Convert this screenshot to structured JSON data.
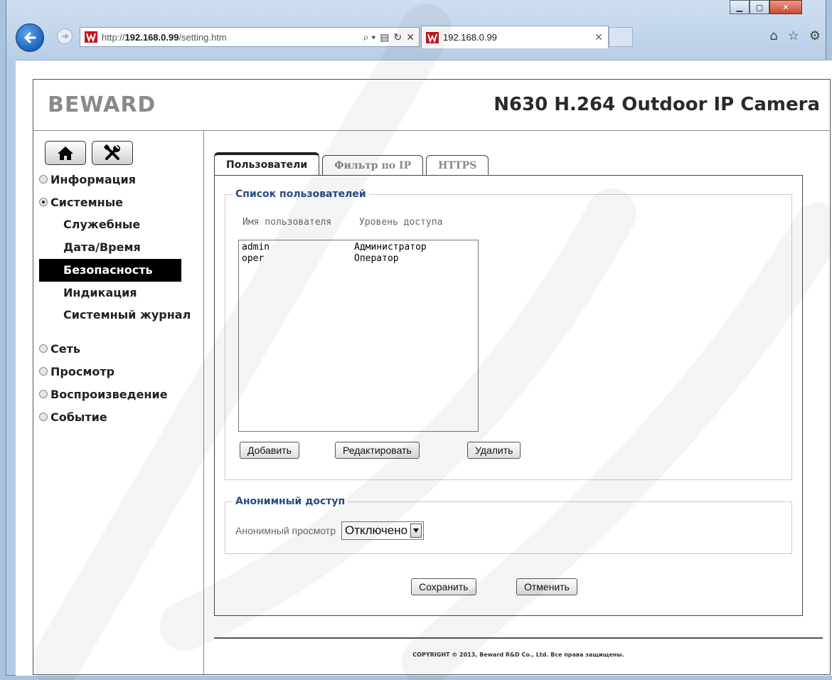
{
  "browser": {
    "url_prefix": "http://",
    "url_host": "192.168.0.99",
    "url_path": "/setting.htm",
    "tab_title": "192.168.0.99",
    "search_glyph": "⌕ ▾",
    "compat_glyph": "▤",
    "refresh_glyph": "↻",
    "stop_glyph": "✕",
    "tab_close_glyph": "✕",
    "home_glyph": "⌂",
    "fav_glyph": "☆",
    "settings_glyph": "⚙",
    "min_glyph": "▁",
    "max_glyph": "▢",
    "close_glyph": "✕"
  },
  "header": {
    "logo": "BEWARD",
    "model": "N630 H.264 Outdoor IP Camera"
  },
  "sidebar": {
    "items": [
      {
        "label": "Информация"
      },
      {
        "label": "Системные"
      },
      {
        "label": "Сеть"
      },
      {
        "label": "Просмотр"
      },
      {
        "label": "Воспроизведение"
      },
      {
        "label": "Событие"
      }
    ],
    "sub_items": [
      {
        "label": "Служебные"
      },
      {
        "label": "Дата/Время"
      },
      {
        "label": "Безопасность"
      },
      {
        "label": "Индикация"
      },
      {
        "label": "Системный журнал"
      }
    ]
  },
  "tabs": [
    {
      "label": "Пользователи"
    },
    {
      "label": "Фильтр по IP"
    },
    {
      "label": "HTTPS"
    }
  ],
  "users_group": {
    "legend": "Список пользователей",
    "col_name": "Имя пользователя",
    "col_level": "Уровень доступа",
    "rows": [
      {
        "name": "admin",
        "level": "Администратор"
      },
      {
        "name": "oper",
        "level": "Оператор"
      }
    ],
    "add_label": "Добавить",
    "edit_label": "Редактировать",
    "delete_label": "Удалить"
  },
  "anon_group": {
    "legend": "Анонимный доступ",
    "label": "Анонимный просмотр",
    "value": "Отключено"
  },
  "actions": {
    "save_label": "Сохранить",
    "cancel_label": "Отменить"
  },
  "footer": {
    "copyright": "COPYRIGHT © 2013, Beward R&D Co., Ltd. Все права защищены."
  }
}
